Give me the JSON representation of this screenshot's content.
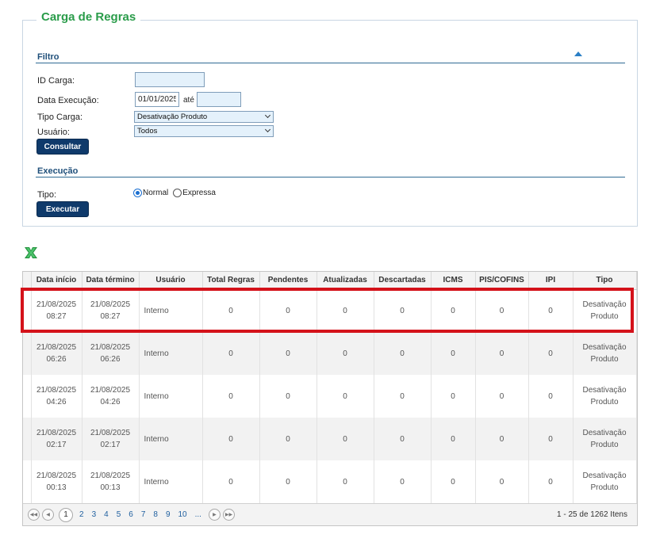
{
  "page": {
    "title": "Carga de Regras",
    "filter_title": "Filtro",
    "execution_title": "Execução"
  },
  "filter": {
    "id_label": "ID Carga:",
    "id_value": "",
    "date_label": "Data Execução:",
    "date_from": "01/01/2025",
    "date_sep": "até",
    "date_to": "",
    "type_label": "Tipo Carga:",
    "type_value": "Desativação Produto",
    "user_label": "Usuário:",
    "user_value": "Todos",
    "submit_label": "Consultar"
  },
  "execution": {
    "type_label": "Tipo:",
    "options": [
      "Normal",
      "Expressa"
    ],
    "selected": "Normal",
    "submit_label": "Executar"
  },
  "grid": {
    "columns": [
      "Data início",
      "Data término",
      "Usuário",
      "Total Regras",
      "Pendentes",
      "Atualizadas",
      "Descartadas",
      "ICMS",
      "PIS/COFINS",
      "IPI",
      "Tipo"
    ],
    "rows": [
      {
        "start_date": "21/08/2025",
        "start_time": "08:27",
        "end_date": "21/08/2025",
        "end_time": "08:27",
        "user": "Interno",
        "total": "0",
        "pending": "0",
        "updated": "0",
        "discarded": "0",
        "icms": "0",
        "pis": "0",
        "ipi": "0",
        "type1": "Desativação",
        "type2": "Produto"
      },
      {
        "start_date": "21/08/2025",
        "start_time": "06:26",
        "end_date": "21/08/2025",
        "end_time": "06:26",
        "user": "Interno",
        "total": "0",
        "pending": "0",
        "updated": "0",
        "discarded": "0",
        "icms": "0",
        "pis": "0",
        "ipi": "0",
        "type1": "Desativação",
        "type2": "Produto"
      },
      {
        "start_date": "21/08/2025",
        "start_time": "04:26",
        "end_date": "21/08/2025",
        "end_time": "04:26",
        "user": "Interno",
        "total": "0",
        "pending": "0",
        "updated": "0",
        "discarded": "0",
        "icms": "0",
        "pis": "0",
        "ipi": "0",
        "type1": "Desativação",
        "type2": "Produto"
      },
      {
        "start_date": "21/08/2025",
        "start_time": "02:17",
        "end_date": "21/08/2025",
        "end_time": "02:17",
        "user": "Interno",
        "total": "0",
        "pending": "0",
        "updated": "0",
        "discarded": "0",
        "icms": "0",
        "pis": "0",
        "ipi": "0",
        "type1": "Desativação",
        "type2": "Produto"
      },
      {
        "start_date": "21/08/2025",
        "start_time": "00:13",
        "end_date": "21/08/2025",
        "end_time": "00:13",
        "user": "Interno",
        "total": "0",
        "pending": "0",
        "updated": "0",
        "discarded": "0",
        "icms": "0",
        "pis": "0",
        "ipi": "0",
        "type1": "Desativação",
        "type2": "Produto"
      }
    ]
  },
  "pager": {
    "pages": [
      "1",
      "2",
      "3",
      "4",
      "5",
      "6",
      "7",
      "8",
      "9",
      "10",
      "..."
    ],
    "current": "1",
    "info": "1 - 25 de 1262 Itens"
  },
  "icons": {
    "export": "excel-icon",
    "collapse": "collapse-up-icon"
  },
  "colors": {
    "accent_green": "#2a9c4a",
    "button_navy": "#0f3a6b",
    "highlight_red": "#d4121a"
  }
}
